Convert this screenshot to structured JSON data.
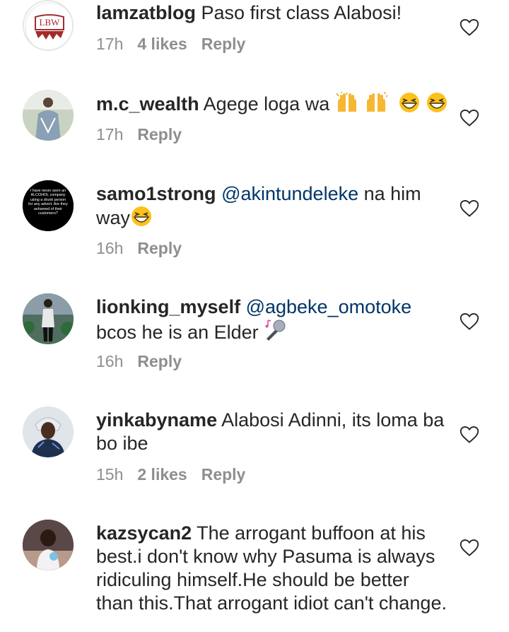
{
  "comments": [
    {
      "username": "lamzatblog",
      "text": "Paso first class Alabosi!",
      "time": "17h",
      "likes": "4 likes",
      "reply": "Reply",
      "avatar_text": "LBW"
    },
    {
      "username": "m.c_wealth",
      "text": "Agege loga wa",
      "time": "17h",
      "likes": "",
      "reply": "Reply"
    },
    {
      "username": "samo1strong",
      "mention": "@akintundeleke",
      "text": "na him way",
      "time": "16h",
      "likes": "",
      "reply": "Reply",
      "avatar_text": "I have never seen an ALCOHOL company using a drunk person for any advert. Are they ashamed of their customers?"
    },
    {
      "username": "lionking_myself",
      "mention": "@agbeke_omotoke",
      "text": "bcos he is an Elder",
      "time": "16h",
      "likes": "",
      "reply": "Reply"
    },
    {
      "username": "yinkabyname",
      "text": "Alabosi Adinni, its loma ba bo ibe",
      "time": "15h",
      "likes": "2 likes",
      "reply": "Reply"
    },
    {
      "username": "kazsycan2",
      "text": "The arrogant buffoon at his best.i don't know why Pasuma is always ridiculing himself.He should be better than this.That arrogant idiot can't change.",
      "time": "",
      "likes": "",
      "reply": ""
    }
  ],
  "icons": {
    "like": "heart-outline-icon",
    "raised_hands": "raising-hands-emoji",
    "grin": "grinning-squinting-emoji",
    "microphone": "microphone-emoji"
  }
}
